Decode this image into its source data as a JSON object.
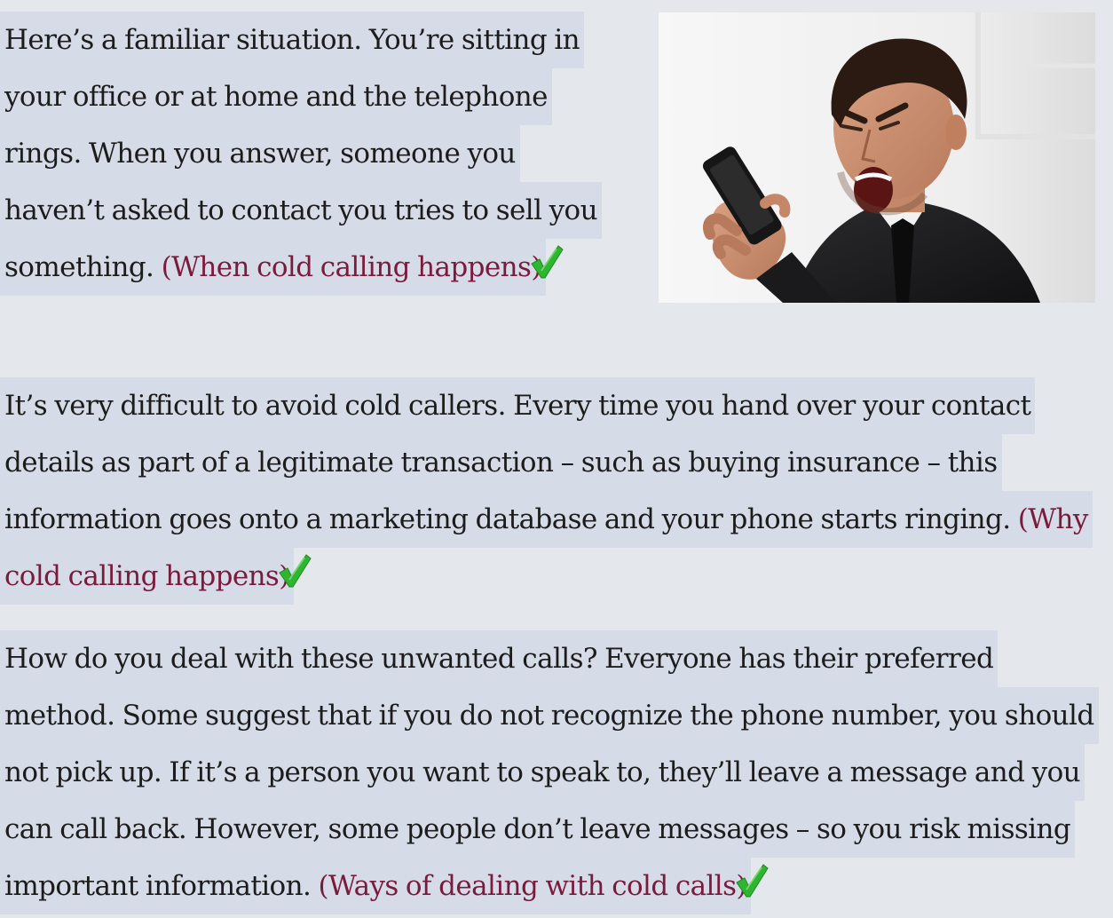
{
  "paragraphs": [
    {
      "text": "Here’s a familiar situation. You’re sitting in your office or at home and the telephone rings. When you answer, someone you haven’t asked to contact you tries to sell you something.",
      "annotation": "(When cold calling happens)"
    },
    {
      "text": "It’s very difficult to avoid cold callers. Every time you hand over your contact details as part of a legitimate transaction – such as buying insurance – this information goes onto a marketing database and your phone starts ringing.",
      "annotation": "(Why cold calling happens)"
    },
    {
      "text": "How do you deal with these unwanted calls? Everyone has their preferred method. Some suggest that if you do not recognize the phone number, you should not pick up. If it’s a person you want to speak to, they’ll leave a message and you can call back. However, some people don’t leave messages – so you risk missing important information.",
      "annotation": "(Ways of dealing with cold calls)"
    }
  ],
  "image": {
    "subject": "angry man shouting into a mobile phone"
  },
  "icons": {
    "checkmark": "checkmark-icon"
  },
  "colors": {
    "page_background": "#e4e8ec",
    "highlight": "#d6dce7",
    "annotation_text": "#7a1b3d",
    "checkmark": "#2fb52f"
  }
}
